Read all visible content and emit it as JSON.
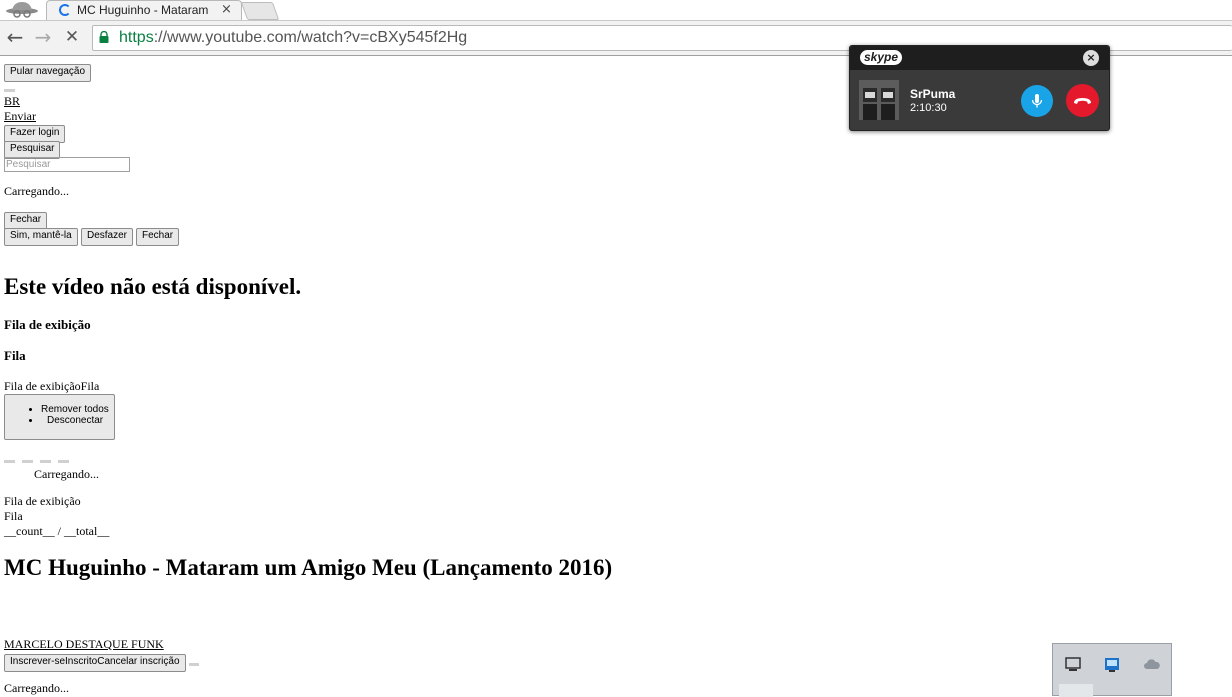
{
  "browser": {
    "tab_title": "MC Huguinho - Mataram",
    "tab_close": "×",
    "url_scheme": "https",
    "url_rest": "://www.youtube.com/watch?v=cBXy545f2Hg",
    "back": "←",
    "forward": "→",
    "stop": "✕"
  },
  "page": {
    "skip_nav": "Pular navegação",
    "region_link": "BR",
    "upload_link": "Enviar",
    "login_button": "Fazer login",
    "search_button": "Pesquisar",
    "search_placeholder": "Pesquisar",
    "loading_1": "Carregando...",
    "close_1": "Fechar",
    "keep_button": "Sim, mantê-la",
    "undo_button": "Desfazer",
    "close_2": "Fechar",
    "unavailable_heading": "Este vídeo não está disponível.",
    "queue_heading": "Fila de exibição",
    "queue_short_heading": "Fila",
    "queue_inline": "Fila de exibiçãoFila",
    "menu_items": [
      "Remover todos",
      "Desconectar"
    ],
    "loading_2": "Carregando...",
    "queue_label": "Fila de exibição",
    "queue_label_short": "Fila",
    "count_placeholder": "__count__ / __total__",
    "video_title": "MC Huguinho - Mataram um Amigo Meu (Lançamento 2016)",
    "channel_link": "MARCELO DESTAQUE FUNK",
    "subscribe_button": "Inscrever-seInscritoCancelar inscrição",
    "loading_3": "Carregando..."
  },
  "skype": {
    "logo": "skype",
    "close": "×",
    "caller_name": "SrPuma",
    "call_duration": "2:10:30",
    "mic_color": "#1aa4e8",
    "end_color": "#e5192c"
  }
}
